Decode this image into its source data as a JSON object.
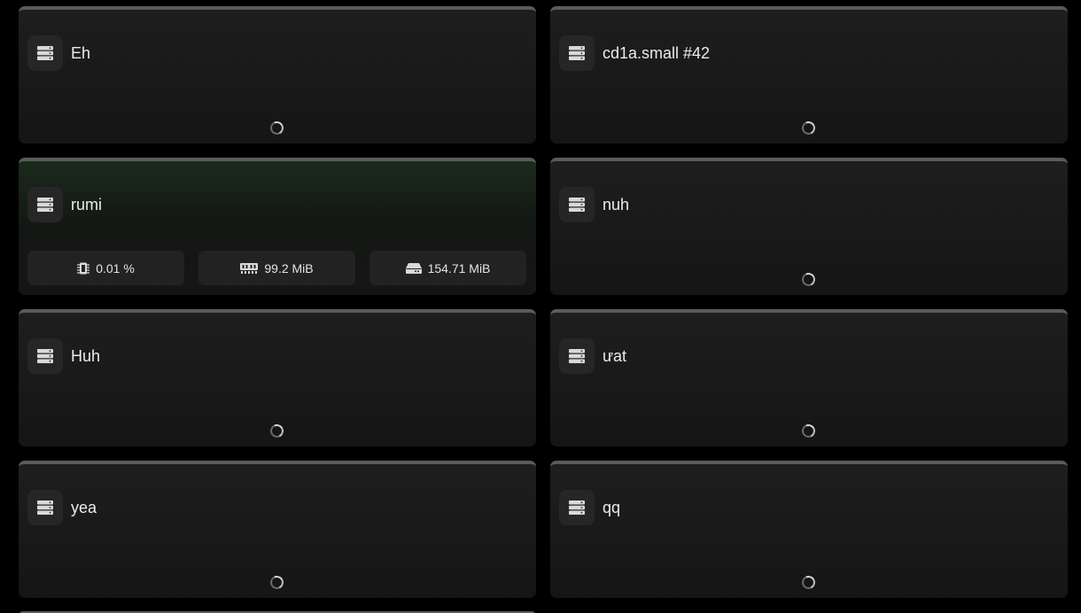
{
  "servers": [
    {
      "name": "Eh"
    },
    {
      "name": "cd1a.small #42"
    },
    {
      "name": "rumi",
      "stats": {
        "cpu": "0.01 %",
        "memory": "99.2 MiB",
        "disk": "154.71 MiB"
      }
    },
    {
      "name": "nuh"
    },
    {
      "name": "Huh"
    },
    {
      "name": "ưat"
    },
    {
      "name": "yea"
    },
    {
      "name": "qq"
    }
  ],
  "icons": {
    "server": "server-icon",
    "cpu": "cpu-icon",
    "memory": "memory-icon",
    "disk": "disk-icon",
    "loading": "loading-spinner"
  },
  "colors": {
    "background": "#000000",
    "card": "#1a1a1a",
    "card_border": "#5b5b5b",
    "active_tint": "#1a2a1c",
    "text": "#ececec"
  }
}
